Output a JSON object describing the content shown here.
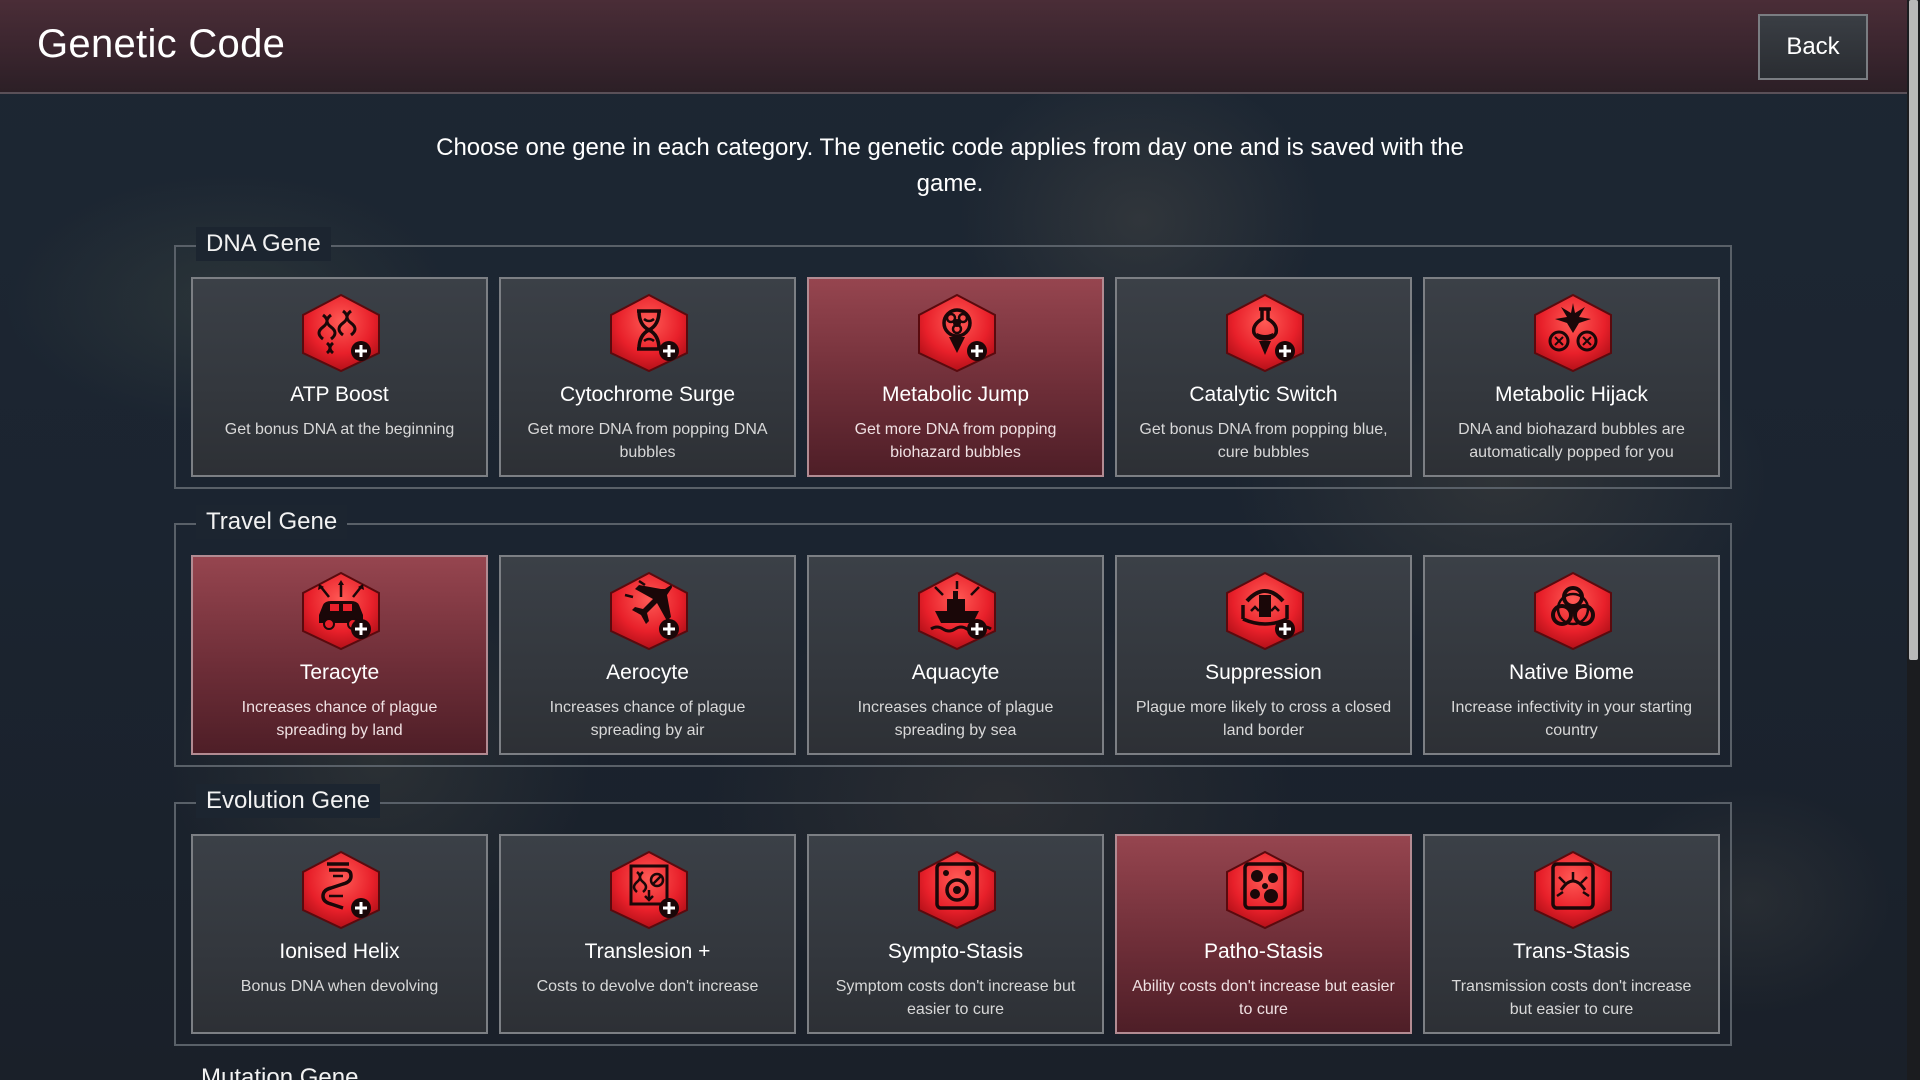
{
  "header": {
    "title": "Genetic Code",
    "back_label": "Back"
  },
  "intro": "Choose one gene in each category. The genetic code applies from day one and is saved with the game.",
  "categories": [
    {
      "title": "DNA Gene",
      "genes": [
        {
          "name": "ATP Boost",
          "desc": "Get bonus DNA at the beginning",
          "icon": "dna-strands-icon",
          "selected": false
        },
        {
          "name": "Cytochrome Surge",
          "desc": "Get more DNA from popping DNA bubbles",
          "icon": "hourglass-dna-icon",
          "selected": false
        },
        {
          "name": "Metabolic Jump",
          "desc": "Get more DNA from popping biohazard bubbles",
          "icon": "biohazard-pin-icon",
          "selected": true
        },
        {
          "name": "Catalytic Switch",
          "desc": "Get bonus DNA from popping blue, cure bubbles",
          "icon": "flask-pin-icon",
          "selected": false
        },
        {
          "name": "Metabolic Hijack",
          "desc": "DNA and biohazard bubbles are automatically popped for you",
          "icon": "burst-bubbles-icon",
          "selected": false
        }
      ]
    },
    {
      "title": "Travel Gene",
      "genes": [
        {
          "name": "Teracyte",
          "desc": "Increases chance of plague spreading by land",
          "icon": "car-icon",
          "selected": true
        },
        {
          "name": "Aerocyte",
          "desc": "Increases chance of plague spreading by air",
          "icon": "airplane-icon",
          "selected": false
        },
        {
          "name": "Aquacyte",
          "desc": "Increases chance of plague spreading by sea",
          "icon": "ship-icon",
          "selected": false
        },
        {
          "name": "Suppression",
          "desc": "Plague more likely to cross a closed land border",
          "icon": "border-gate-icon",
          "selected": false
        },
        {
          "name": "Native Biome",
          "desc": "Increase infectivity in your starting country",
          "icon": "biohazard-icon",
          "selected": false
        }
      ]
    },
    {
      "title": "Evolution Gene",
      "genes": [
        {
          "name": "Ionised Helix",
          "desc": "Bonus DNA when devolving",
          "icon": "helix-icon",
          "selected": false
        },
        {
          "name": "Translesion +",
          "desc": "Costs to devolve don't increase",
          "icon": "devolve-cost-icon",
          "selected": false
        },
        {
          "name": "Sympto-Stasis",
          "desc": "Symptom costs don't increase but easier to cure",
          "icon": "symptom-cells-icon",
          "selected": false
        },
        {
          "name": "Patho-Stasis",
          "desc": "Ability costs don't increase but easier to cure",
          "icon": "hexagon-cells-icon",
          "selected": true
        },
        {
          "name": "Trans-Stasis",
          "desc": "Transmission costs don't increase but easier to cure",
          "icon": "transmission-icon",
          "selected": false
        }
      ]
    }
  ],
  "next_category_title": "Mutation Gene",
  "colors": {
    "accent_red": "#e8202a",
    "selected_card": "#7a3440",
    "header": "#3a252e"
  }
}
